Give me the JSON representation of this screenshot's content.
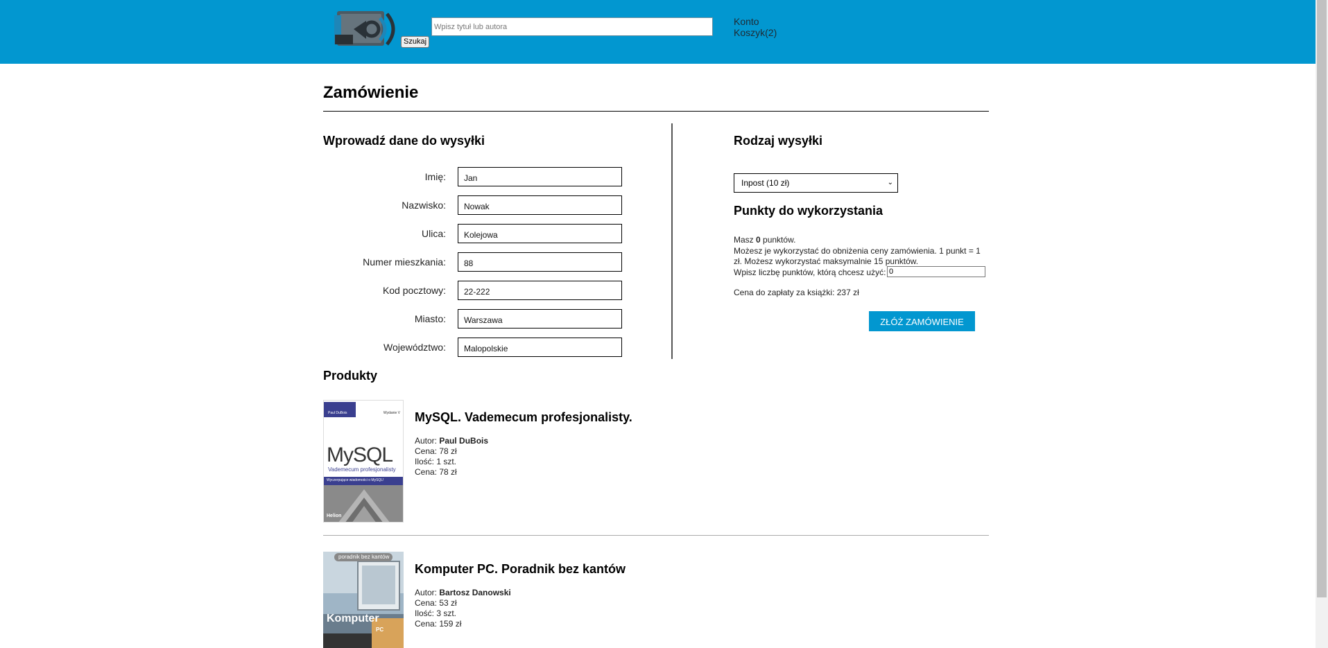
{
  "header": {
    "search_placeholder": "Wpisz tytuł lub autora",
    "search_button": "Szukaj",
    "account_link": "Konto",
    "cart_link": "Koszyk(2)"
  },
  "page": {
    "title": "Zamówienie"
  },
  "shipping_form": {
    "heading": "Wprowadź dane do wysyłki",
    "fields": [
      {
        "label": "Imię:",
        "value": "Jan"
      },
      {
        "label": "Nazwisko:",
        "value": "Nowak"
      },
      {
        "label": "Ulica:",
        "value": "Kolejowa"
      },
      {
        "label": "Numer mieszkania:",
        "value": "88"
      },
      {
        "label": "Kod pocztowy:",
        "value": "22-222"
      },
      {
        "label": "Miasto:",
        "value": "Warszawa"
      },
      {
        "label": "Województwo:",
        "value": "Malopolskie"
      }
    ]
  },
  "shipping_type": {
    "heading": "Rodzaj wysyłki",
    "selected": "Inpost (10 zł)"
  },
  "points": {
    "heading": "Punkty do wykorzystania",
    "have_prefix": "Masz ",
    "have_value": "0",
    "have_suffix": " punktów.",
    "info": "Możesz je wykorzystać do obniżenia ceny zamówienia. 1 punkt = 1 zł. Możesz wykorzystać maksymalnie 15 punktów.",
    "input_label": "Wpisz liczbę punktów, którą chcesz użyć:",
    "input_value": "0",
    "price_total": "Cena do zapłaty za książki: 237 zł",
    "order_button": "ZŁÓŻ ZAMÓWIENIE"
  },
  "products": {
    "heading": "Produkty",
    "items": [
      {
        "title": "MySQL. Vademecum profesjonalisty.",
        "author_label": "Autor: ",
        "author": "Paul DuBois",
        "price": "Cena: 78 zł",
        "quantity": "Ilość: 1 szt.",
        "total": "Cena: 78 zł",
        "cover": {
          "author_tag": "Paul DuBois",
          "edition": "Wydanie V",
          "big_title": "MySQL",
          "subtitle": "Vademecum profesjonalisty",
          "band_text": "Wyczerpujące wiadomości o MySQL!",
          "publisher": "Helion"
        }
      },
      {
        "title": "Komputer PC. Poradnik bez kantów",
        "author_label": "Autor: ",
        "author": "Bartosz Danowski",
        "price": "Cena: 53 zł",
        "quantity": "Ilość: 3 szt.",
        "total": "Cena: 159 zł",
        "cover": {
          "tag": "poradnik bez kantów",
          "big_title": "Komputer",
          "badge": "PC"
        }
      }
    ]
  }
}
